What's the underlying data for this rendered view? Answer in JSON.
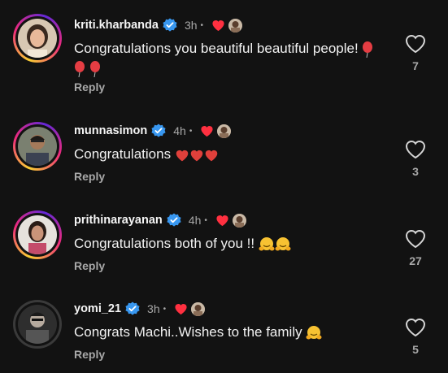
{
  "comments": [
    {
      "username": "kriti.kharbanda",
      "time": "3h",
      "dot": "•",
      "text": "Congratulations you beautiful beautiful people!",
      "emoji": "balloon",
      "reply": "Reply",
      "likes": "7",
      "verified": true
    },
    {
      "username": "munnasimon",
      "time": "4h",
      "dot": "•",
      "text": "Congratulations",
      "emoji": "red-hearts",
      "reply": "Reply",
      "likes": "3",
      "verified": true
    },
    {
      "username": "prithinarayanan",
      "time": "4h",
      "dot": "•",
      "text": "Congratulations both of you !!",
      "emoji": "hugging-face",
      "reply": "Reply",
      "likes": "27",
      "verified": true
    },
    {
      "username": "yomi_21",
      "time": "3h",
      "dot": "•",
      "text": "Congrats Machi..Wishes to the family",
      "emoji": "hugging-face",
      "reply": "Reply",
      "likes": "5",
      "verified": true
    }
  ],
  "colors": {
    "background": "#121212",
    "verified": "#3897f0",
    "heart": "#ff3040",
    "muted": "#a8a8a8"
  }
}
